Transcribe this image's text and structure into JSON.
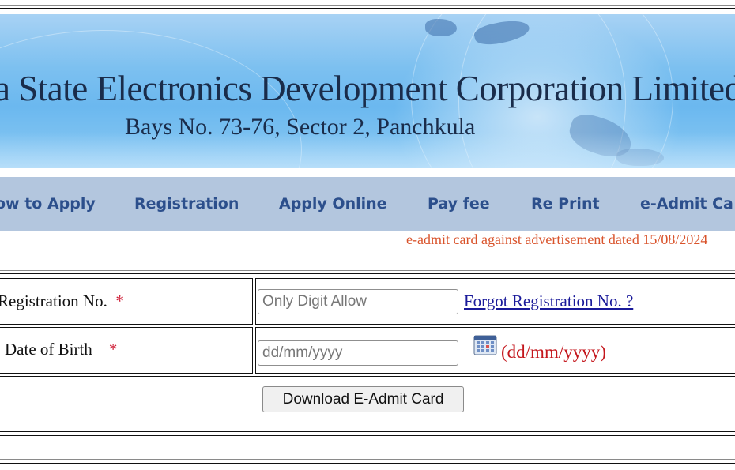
{
  "header": {
    "title": "a State Electronics Development Corporation Limited",
    "address": "Bays No. 73-76, Sector 2, Panchkula"
  },
  "nav": {
    "items": [
      {
        "label": "ow to Apply"
      },
      {
        "label": "Registration"
      },
      {
        "label": "Apply Online"
      },
      {
        "label": "Pay fee"
      },
      {
        "label": "Re Print"
      },
      {
        "label": "e-Admit Ca"
      }
    ]
  },
  "notice": "e-admit card against advertisement dated 15/08/2024",
  "form": {
    "registration": {
      "label": "Registration No.",
      "required_mark": "*",
      "placeholder": "Only Digit Allow",
      "value": "",
      "forgot_link": "Forgot Registration No. ?"
    },
    "dob": {
      "label": "Date of Birth",
      "required_mark": "*",
      "placeholder": "dd/mm/yyyy",
      "value": "",
      "format_hint": "(dd/mm/yyyy)",
      "calendar_icon": "calendar-icon"
    },
    "submit_label": "Download E-Admit Card"
  },
  "colors": {
    "nav_background": "#b3c6de",
    "nav_text": "#2c4f8c",
    "notice_text": "#d9532b",
    "required_star": "#d0223a",
    "link": "#1a1a9a",
    "hint": "#c4161c"
  }
}
